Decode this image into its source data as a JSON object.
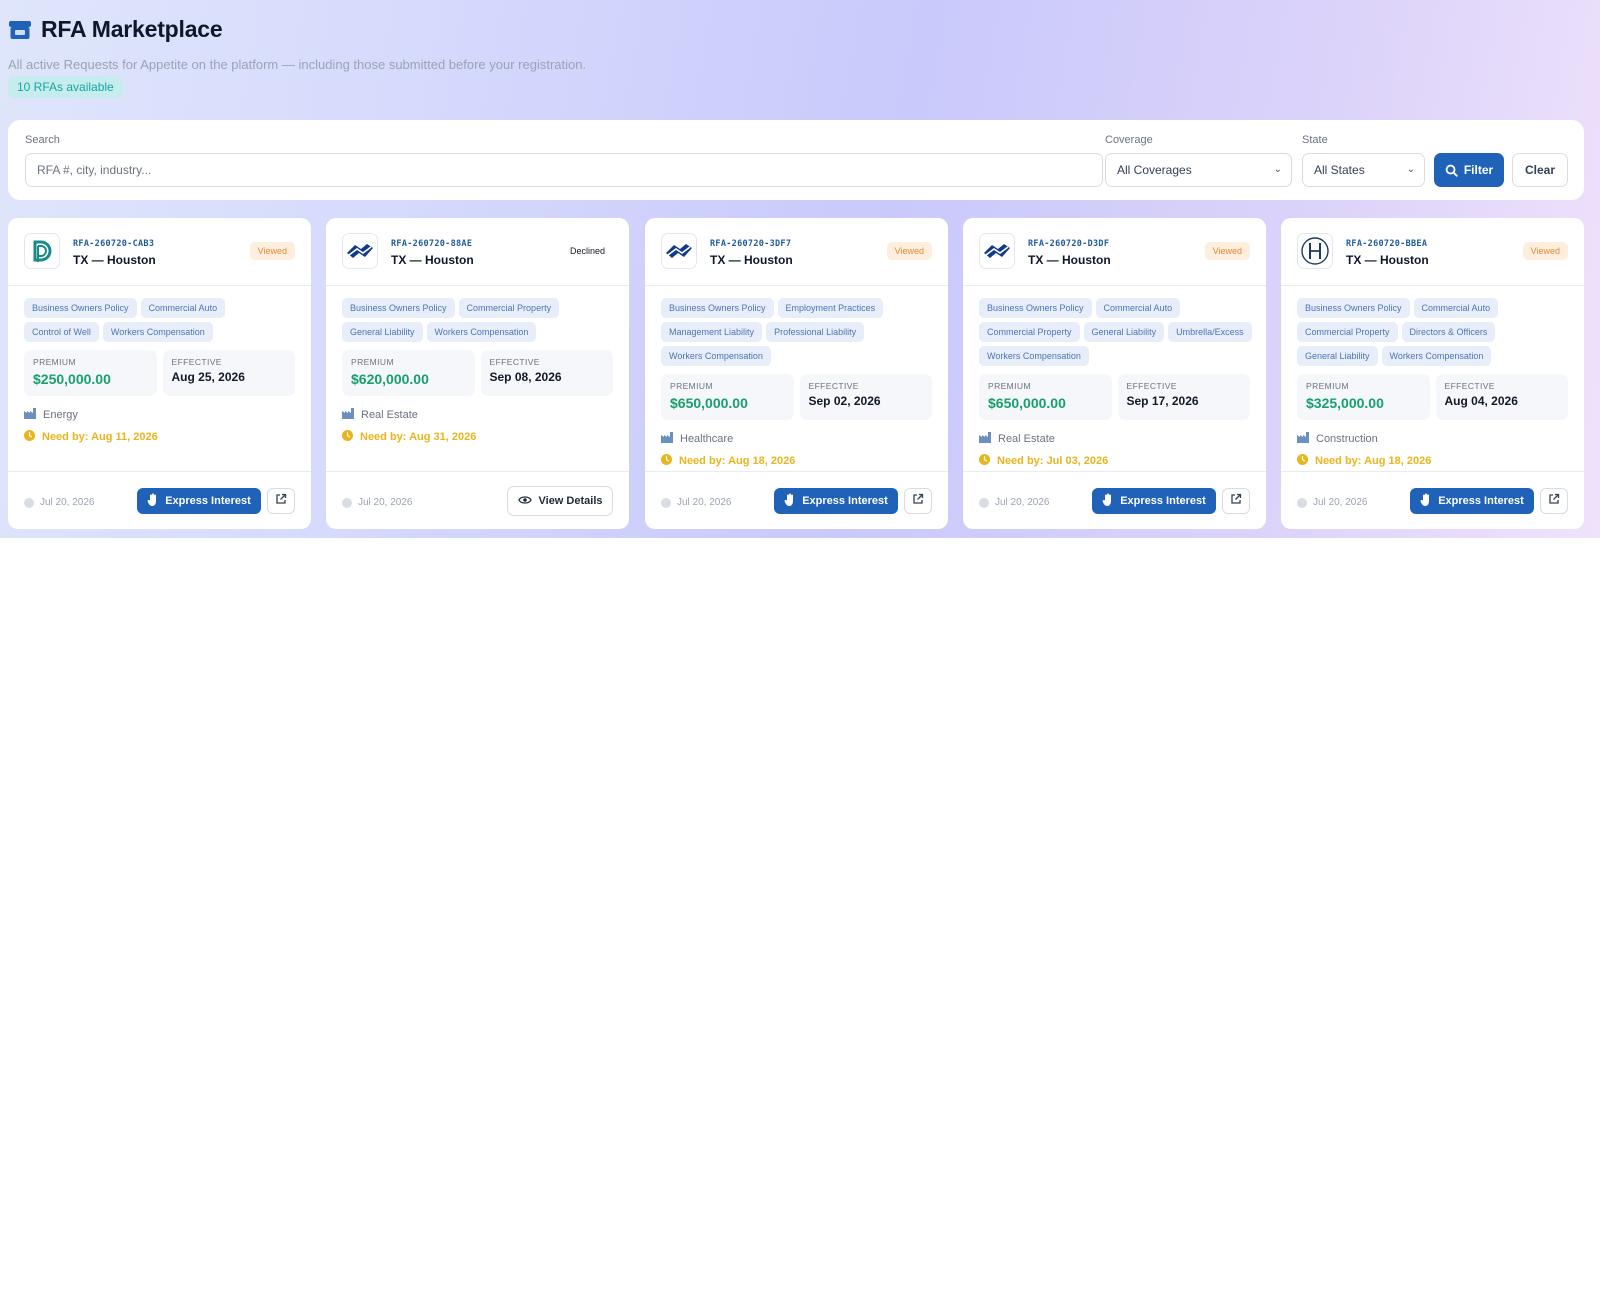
{
  "header": {
    "title": "RFA Marketplace",
    "subtitle": "All active Requests for Appetite on the platform — including those submitted before your registration.",
    "count_badge": "10 RFAs available"
  },
  "filters": {
    "search_label": "Search",
    "search_placeholder": "RFA #, city, industry...",
    "coverage_label": "Coverage",
    "coverage_value": "All Coverages",
    "state_label": "State",
    "state_value": "All States",
    "filter_button": "Filter",
    "clear_button": "Clear"
  },
  "labels": {
    "premium": "PREMIUM",
    "effective": "EFFECTIVE",
    "express_interest": "Express Interest",
    "view_details": "View Details"
  },
  "colors": {
    "accent": "#1f62b8",
    "premium_green": "#16a06a",
    "needby_yellow": "#eab41d",
    "viewed_orange": "#e58a3a"
  },
  "cards": [
    {
      "id": "RFA-260720-CAB3",
      "location": "TX — Houston",
      "status": "Viewed",
      "logo": "d-logo-icon",
      "coverages": [
        "Business Owners Policy",
        "Commercial Auto",
        "Control of Well",
        "Workers Compensation"
      ],
      "premium": "$250,000.00",
      "effective": "Aug 25, 2026",
      "industry": "Energy",
      "need_by": "Need by: Aug 11, 2026",
      "posted": "Jul 20, 2026",
      "action": "express"
    },
    {
      "id": "RFA-260720-88AE",
      "location": "TX — Houston",
      "status": "Declined",
      "logo": "wave-logo-icon",
      "coverages": [
        "Business Owners Policy",
        "Commercial Property",
        "General Liability",
        "Workers Compensation"
      ],
      "premium": "$620,000.00",
      "effective": "Sep 08, 2026",
      "industry": "Real Estate",
      "need_by": "Need by: Aug 31, 2026",
      "posted": "Jul 20, 2026",
      "action": "view"
    },
    {
      "id": "RFA-260720-3DF7",
      "location": "TX — Houston",
      "status": "Viewed",
      "logo": "wave-logo-icon",
      "coverages": [
        "Business Owners Policy",
        "Employment Practices",
        "Management Liability",
        "Professional Liability",
        "Workers Compensation"
      ],
      "premium": "$650,000.00",
      "effective": "Sep 02, 2026",
      "industry": "Healthcare",
      "need_by": "Need by: Aug 18, 2026",
      "posted": "Jul 20, 2026",
      "action": "express"
    },
    {
      "id": "RFA-260720-D3DF",
      "location": "TX — Houston",
      "status": "Viewed",
      "logo": "wave-logo-icon",
      "coverages": [
        "Business Owners Policy",
        "Commercial Auto",
        "Commercial Property",
        "General Liability",
        "Umbrella/Excess",
        "Workers Compensation"
      ],
      "premium": "$650,000.00",
      "effective": "Sep 17, 2026",
      "industry": "Real Estate",
      "need_by": "Need by: Jul 03, 2026",
      "posted": "Jul 20, 2026",
      "action": "express"
    },
    {
      "id": "RFA-260720-BBEA",
      "location": "TX — Houston",
      "status": "Viewed",
      "logo": "h-logo-icon",
      "coverages": [
        "Business Owners Policy",
        "Commercial Auto",
        "Commercial Property",
        "Directors & Officers",
        "General Liability",
        "Workers Compensation"
      ],
      "premium": "$325,000.00",
      "effective": "Aug 04, 2026",
      "industry": "Construction",
      "need_by": "Need by: Aug 18, 2026",
      "posted": "Jul 20, 2026",
      "action": "express"
    }
  ]
}
